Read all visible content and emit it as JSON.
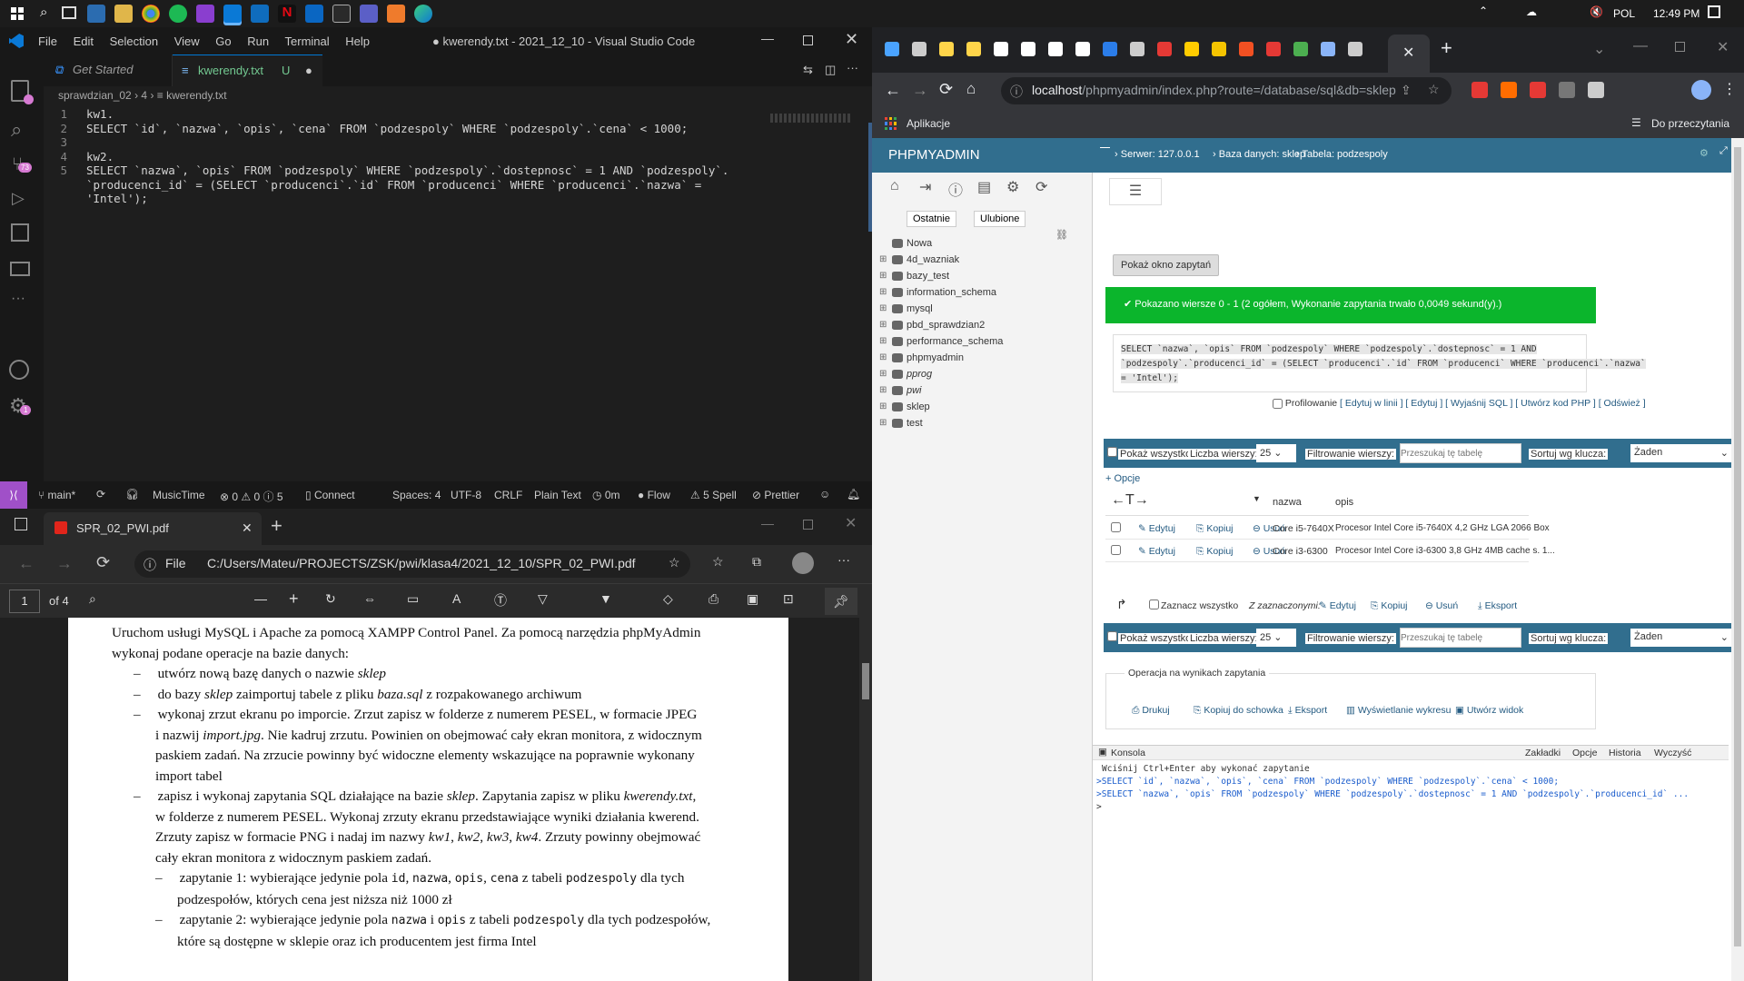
{
  "taskbar": {
    "lang": "POL",
    "time": "12:49 PM"
  },
  "vscode": {
    "menu": [
      "File",
      "Edit",
      "Selection",
      "View",
      "Go",
      "Run",
      "Terminal",
      "Help"
    ],
    "title": "● kwerendy.txt - 2021_12_10 - Visual Studio Code",
    "tabs": [
      {
        "label": "Get Started"
      },
      {
        "label": "kwerendy.txt",
        "status": "U"
      }
    ],
    "breadcrumb": [
      "sprawdzian_02",
      "4",
      "kwerendy.txt"
    ],
    "lines": [
      {
        "n": "1",
        "text": "kw1."
      },
      {
        "n": "2",
        "text": "SELECT `id`, `nazwa`, `opis`, `cena` FROM `podzespoly` WHERE `podzespoly`.`cena` < 1000;"
      },
      {
        "n": "3",
        "text": ""
      },
      {
        "n": "4",
        "text": "kw2."
      },
      {
        "n": "5",
        "text": "SELECT `nazwa`, `opis` FROM `podzespoly` WHERE `podzespoly`.`dostepnosc` = 1 AND `podzespoly`."
      },
      {
        "n": "",
        "text": "`producenci_id` = (SELECT `producenci`.`id` FROM `producenci` WHERE `producenci`.`nazwa` ="
      },
      {
        "n": "",
        "text": "'Intel');"
      }
    ],
    "badges": {
      "scm": "73",
      "accounts": "1",
      "settings": "1"
    },
    "status": {
      "branch": "main*",
      "music": "MusicTime",
      "problems": "⊗ 0 ⚠ 0 ⓘ 5",
      "connect": "Connect",
      "spaces": "Spaces: 4",
      "encoding": "UTF-8",
      "eol": "CRLF",
      "lang": "Plain Text",
      "time": "0m",
      "flow": "Flow",
      "spell": "5 Spell",
      "prettier": "Prettier"
    }
  },
  "pdf": {
    "tab": "SPR_02_PWI.pdf",
    "file_label": "File",
    "path": "C:/Users/Mateu/PROJECTS/ZSK/pwi/klasa4/2021_12_10/SPR_02_PWI.pdf",
    "page": "1",
    "pages": "of 4",
    "paragraphs": [
      "Uruchom usługi MySQL i Apache za pomocą XAMPP Control Panel. Za pomocą narzędzia phpMyAdmin",
      "wykonaj podane operacje na bazie danych:"
    ],
    "items": [
      [
        "–",
        "utwórz nową bazę danych o nazwie ",
        "sklep",
        ""
      ],
      [
        "–",
        "do bazy ",
        "sklep",
        " zaimportuj tabele z pliku "
      ],
      [
        "–",
        "wykonaj zrzut ekranu po imporcie. Zrzut zapisz w folderze z numerem PESEL, w formacie JPEG",
        ""
      ]
    ],
    "l_sklep_file": "baza.sql",
    "l_archive": " z rozpakowanego archiwum",
    "l3": "i nazwij ",
    "l3i": "import.jpg",
    "l3b": ". Nie kadruj zrzutu. Powinien on obejmować cały ekran monitora, z widocznym",
    "l4": "paskiem zadań. Na zrzucie powinny być widoczne elementy wskazujące na poprawnie wykonany",
    "l5": "import tabel",
    "l6a": "zapisz i wykonaj zapytania SQL działające na bazie ",
    "l6b": "sklep",
    "l6c": ". Zapytania zapisz w pliku ",
    "l6d": "kwerendy.txt",
    "l6e": ",",
    "l7": "w folderze z numerem PESEL. Wykonaj zrzuty ekranu przedstawiające wyniki działania kwerend.",
    "l8a": "Zrzuty zapisz w formacie PNG i nadaj im nazwy ",
    "l8b": "kw1",
    "l8c": "kw2",
    "l8d": "kw3",
    "l8e": "kw4",
    "l8f": ". Zrzuty powinny obejmować",
    "l9": "cały ekran monitora z widocznym paskiem zadań.",
    "q1a": "zapytanie 1: wybierające jedynie pola ",
    "q1b": "id",
    "q1c": "nazwa",
    "q1d": "opis",
    "q1e": "cena",
    "q1f": " z tabeli ",
    "q1g": "podzespoly",
    "q1h": " dla tych",
    "q1i": "podzespołów, których cena jest niższa niż 1000 zł",
    "q2a": "zapytanie 2: wybierające jedynie pola ",
    "q2b": "nazwa",
    "q2c": " i ",
    "q2d": "opis",
    "q2e": " z tabeli ",
    "q2f": "podzespoly",
    "q2g": " dla tych podzespołów,",
    "q2h": "które są dostępne w sklepie oraz ich producentem jest firma Intel"
  },
  "chrome": {
    "url_host": "localhost",
    "url_path": "/phpmyadmin/index.php?route=/database/sql&db=sklep",
    "apps": "Aplikacje",
    "reading_list": "Do przeczytania"
  },
  "pma": {
    "logo": "PHPMYADMIN",
    "breadcrumb": [
      "Serwer: 127.0.0.1",
      "Baza danych: sklep",
      "Tabela: podzespoly"
    ],
    "tabs_left": [
      "Ostatnie",
      "Ulubione"
    ],
    "dbs": [
      "Nowa",
      "4d_wazniak",
      "bazy_test",
      "information_schema",
      "mysql",
      "pbd_sprawdzian2",
      "performance_schema",
      "phpmyadmin",
      "pprog",
      "pwi",
      "sklep",
      "test"
    ],
    "show_query": "Pokaż okno zapytań",
    "success": "Pokazano wiersze 0 - 1 (2 ogółem, Wykonanie zapytania trwało 0,0049 sekund(y).)",
    "sql": [
      "SELECT `nazwa`, `opis` FROM `podzespoly` WHERE `podzespoly`.`dostepnosc` = 1 AND",
      "`podzespoly`.`producenci_id` = (SELECT `producenci`.`id` FROM `producenci` WHERE `producenci`.`nazwa`",
      "= 'Intel');"
    ],
    "profiling": "Profilowanie",
    "links": "[ Edytuj w linii ] [ Edytuj ] [ Wyjaśnij SQL ] [ Utwórz kod PHP ] [ Odśwież ]",
    "show_all": "Pokaż wszystko",
    "rows_label": "Liczba wierszy:",
    "rows_value": "25",
    "filter_label": "Filtrowanie wierszy:",
    "filter_placeholder": "Przeszukaj tę tabelę",
    "sort_label": "Sortuj wg klucza:",
    "sort_value": "Żaden",
    "options": "+ Opcje",
    "columns": [
      "nazwa",
      "opis"
    ],
    "row_actions": [
      "Edytuj",
      "Kopiuj",
      "Usuń"
    ],
    "rows": [
      {
        "nazwa": "Core i5-7640X",
        "opis": "Procesor Intel Core i5-7640X 4,2 GHz LGA 2066 Box"
      },
      {
        "nazwa": "Core i3-6300",
        "opis": "Procesor Intel Core i3-6300 3,8 GHz 4MB cache s. 1..."
      }
    ],
    "check_all": "Zaznacz wszystko",
    "with_selected": "Z zaznaczonymi:",
    "bulk": [
      "Edytuj",
      "Kopiuj",
      "Usuń",
      "Eksport"
    ],
    "ops_title": "Operacja na wynikach zapytania",
    "ops": [
      "Drukuj",
      "Kopiuj do schowka",
      "Eksport",
      "Wyświetlanie wykresu",
      "Utwórz widok"
    ],
    "console": {
      "title": "Konsola",
      "tabs": [
        "Zakładki",
        "Opcje",
        "Historia",
        "Wyczyść"
      ],
      "hint": "Wciśnij Ctrl+Enter aby wykonać zapytanie",
      "q1": "SELECT `id`, `nazwa`, `opis`, `cena` FROM `podzespoly` WHERE `podzespoly`.`cena` < 1000;",
      "q2": "SELECT `nazwa`, `opis` FROM `podzespoly` WHERE `podzespoly`.`dostepnosc` = 1 AND `podzespoly`.`producenci_id` ...",
      "prompt": ">"
    }
  }
}
